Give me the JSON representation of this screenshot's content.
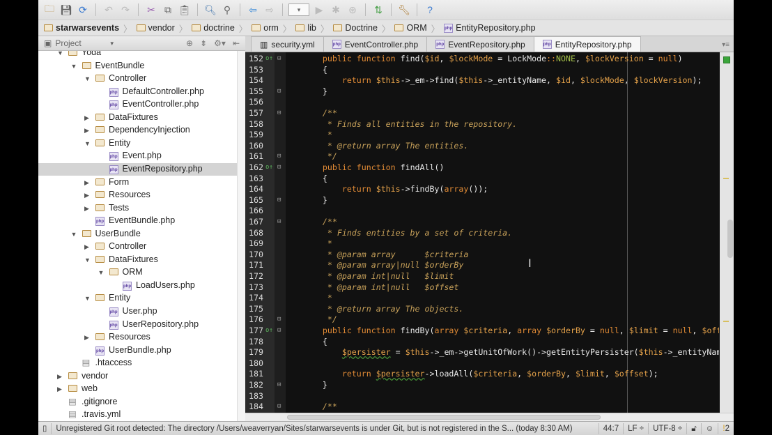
{
  "toolbar": {
    "icons": [
      "open-icon",
      "save-icon",
      "sync-icon",
      "undo-icon",
      "redo-icon",
      "cut-icon",
      "copy-icon",
      "paste-icon",
      "find-icon",
      "replace-icon",
      "back-icon",
      "forward-icon",
      "run-config-dropdown",
      "run-icon",
      "debug-icon",
      "coverage-icon",
      "vcs-icon",
      "settings-icon",
      "help-icon"
    ]
  },
  "breadcrumbs": [
    "starwarsevents",
    "vendor",
    "doctrine",
    "orm",
    "lib",
    "Doctrine",
    "ORM",
    "EntityRepository.php"
  ],
  "panel": {
    "title": "Project"
  },
  "tree": [
    {
      "label": "Yoda",
      "level": 1,
      "type": "folder",
      "open": true
    },
    {
      "label": "EventBundle",
      "level": 2,
      "type": "folder",
      "open": true
    },
    {
      "label": "Controller",
      "level": 3,
      "type": "folder",
      "open": true
    },
    {
      "label": "DefaultController.php",
      "level": 4,
      "type": "php"
    },
    {
      "label": "EventController.php",
      "level": 4,
      "type": "php"
    },
    {
      "label": "DataFixtures",
      "level": 3,
      "type": "folder",
      "open": false
    },
    {
      "label": "DependencyInjection",
      "level": 3,
      "type": "folder",
      "open": false
    },
    {
      "label": "Entity",
      "level": 3,
      "type": "folder",
      "open": true
    },
    {
      "label": "Event.php",
      "level": 4,
      "type": "php"
    },
    {
      "label": "EventRepository.php",
      "level": 4,
      "type": "php",
      "selected": true
    },
    {
      "label": "Form",
      "level": 3,
      "type": "folder",
      "open": false
    },
    {
      "label": "Resources",
      "level": 3,
      "type": "folder",
      "open": false
    },
    {
      "label": "Tests",
      "level": 3,
      "type": "folder",
      "open": false
    },
    {
      "label": "EventBundle.php",
      "level": 3,
      "type": "php"
    },
    {
      "label": "UserBundle",
      "level": 2,
      "type": "folder",
      "open": true
    },
    {
      "label": "Controller",
      "level": 3,
      "type": "folder",
      "open": false
    },
    {
      "label": "DataFixtures",
      "level": 3,
      "type": "folder",
      "open": true
    },
    {
      "label": "ORM",
      "level": 4,
      "type": "folder",
      "open": true
    },
    {
      "label": "LoadUsers.php",
      "level": 5,
      "type": "php"
    },
    {
      "label": "Entity",
      "level": 3,
      "type": "folder",
      "open": true
    },
    {
      "label": "User.php",
      "level": 4,
      "type": "php"
    },
    {
      "label": "UserRepository.php",
      "level": 4,
      "type": "php"
    },
    {
      "label": "Resources",
      "level": 3,
      "type": "folder",
      "open": false
    },
    {
      "label": "UserBundle.php",
      "level": 3,
      "type": "php"
    },
    {
      "label": ".htaccess",
      "level": 2,
      "type": "file"
    },
    {
      "label": "vendor",
      "level": 1,
      "type": "folder",
      "open": false
    },
    {
      "label": "web",
      "level": 1,
      "type": "folder",
      "open": false
    },
    {
      "label": ".gitignore",
      "level": 1,
      "type": "file"
    },
    {
      "label": ".travis.yml",
      "level": 1,
      "type": "file"
    }
  ],
  "tabs": [
    {
      "label": "security.yml",
      "type": "yml"
    },
    {
      "label": "EventController.php",
      "type": "php"
    },
    {
      "label": "EventRepository.php",
      "type": "php"
    },
    {
      "label": "EntityRepository.php",
      "type": "php",
      "active": true
    }
  ],
  "editor": {
    "first_line": 152,
    "override_lines": [
      152,
      162,
      177
    ],
    "fold_lines": [
      152,
      155,
      157,
      161,
      162,
      165,
      167,
      176,
      177,
      182,
      184
    ],
    "lines": [
      "    public function find($id, $lockMode = LockMode::NONE, $lockVersion = null)",
      "    {",
      "        return $this->_em->find($this->_entityName, $id, $lockMode, $lockVersion);",
      "    }",
      "",
      "    /**",
      "     * Finds all entities in the repository.",
      "     *",
      "     * @return array The entities.",
      "     */",
      "    public function findAll()",
      "    {",
      "        return $this->findBy(array());",
      "    }",
      "",
      "    /**",
      "     * Finds entities by a set of criteria.",
      "     *",
      "     * @param array      $criteria",
      "     * @param array|null $orderBy",
      "     * @param int|null   $limit",
      "     * @param int|null   $offset",
      "     *",
      "     * @return array The objects.",
      "     */",
      "    public function findBy(array $criteria, array $orderBy = null, $limit = null, $offset =",
      "    {",
      "        $persister = $this->_em->getUnitOfWork()->getEntityPersister($this->_entityName);",
      "",
      "        return $persister->loadAll($criteria, $orderBy, $limit, $offset);",
      "    }",
      "",
      "    /**"
    ]
  },
  "status": {
    "message": "Unregistered Git root detected: The directory /Users/weaverryan/Sites/starwarsevents is under Git, but is not registered in the S... (today 8:30 AM)",
    "position": "44:7",
    "line_sep": "LF ÷",
    "encoding": "UTF-8 ÷",
    "warnings": "2"
  },
  "colors": {
    "keyword": "#e08a35",
    "variable": "#e5a24a",
    "comment": "#c9a25a",
    "constant": "#a5c24a",
    "editor_bg": "#111111"
  }
}
